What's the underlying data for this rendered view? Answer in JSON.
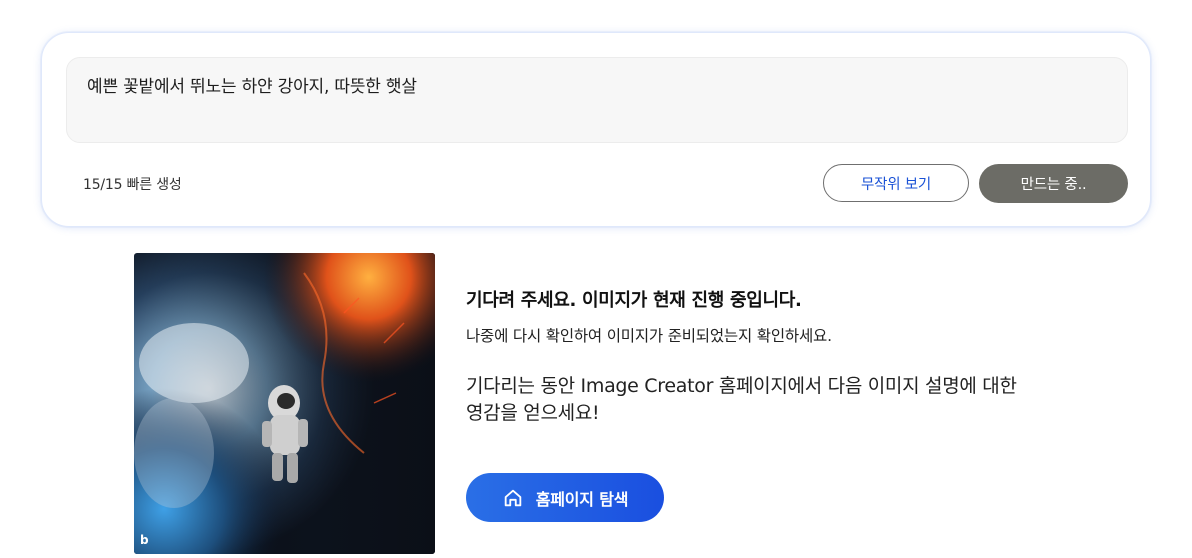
{
  "prompt": {
    "text": "예쁜 꽃밭에서 뛰노는 하얀 강아지, 따뜻한 햇살",
    "boost_count": "15/15 빠른 생성",
    "surprise_label": "무작위 보기",
    "create_label": "만드는 중.."
  },
  "waiting": {
    "title": "기다려 주세요. 이미지가 현재 진행 중입니다.",
    "subtitle": "나중에 다시 확인하여 이미지가 준비되었는지 확인하세요.",
    "inspire_text": "기다리는 동안 Image Creator 홈페이지에서 다음 이미지 설명에 대한 영감을 얻으세요!",
    "explore_label": "홈페이지 탐색"
  },
  "preview": {
    "logo": "b",
    "icon": "home-icon"
  },
  "colors": {
    "accent": "#1a4fe0",
    "surprise_text": "#1a52d6",
    "create_bg": "#6c6c66"
  }
}
